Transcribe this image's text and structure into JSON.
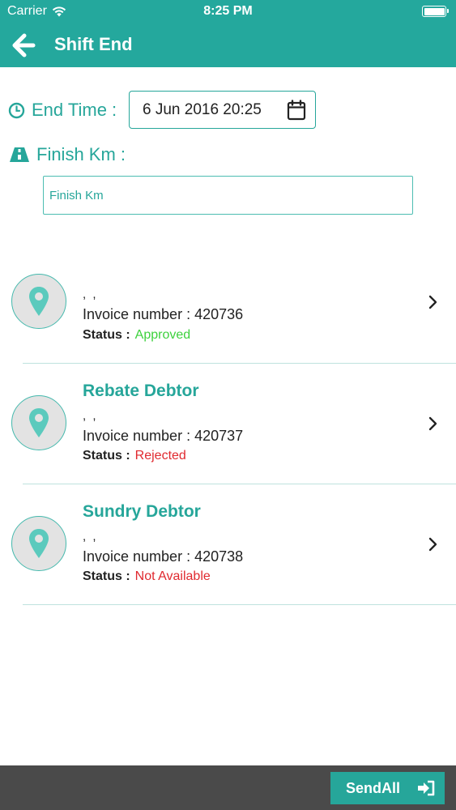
{
  "status_bar": {
    "carrier": "Carrier",
    "time": "8:25 PM"
  },
  "header": {
    "title": "Shift End"
  },
  "form": {
    "end_time_label": "End Time :",
    "end_time_value": "6 Jun 2016 20:25",
    "finish_km_label": "Finish Km :",
    "finish_km_placeholder": "Finish Km",
    "finish_km_value": ""
  },
  "invoices": [
    {
      "title": "",
      "address": ", ,",
      "invoice_label": "Invoice number :",
      "invoice_number": "420736",
      "status_label": "Status :",
      "status": "Approved",
      "status_color": "#3dd13d"
    },
    {
      "title": "Rebate Debtor",
      "address": ", ,",
      "invoice_label": "Invoice number :",
      "invoice_number": "420737",
      "status_label": "Status :",
      "status": "Rejected",
      "status_color": "#e0292f"
    },
    {
      "title": "Sundry Debtor",
      "address": ", ,",
      "invoice_label": "Invoice number :",
      "invoice_number": "420738",
      "status_label": "Status :",
      "status": "Not Available",
      "status_color": "#e0292f"
    }
  ],
  "footer": {
    "send_all_label": "SendAll"
  },
  "icons": {
    "back": "arrow-left-icon",
    "clock": "clock-icon",
    "road": "road-icon",
    "calendar": "calendar-icon",
    "location": "map-pin-icon",
    "chevron": "chevron-right-icon",
    "send": "sign-in-icon",
    "wifi": "wifi-icon",
    "battery": "battery-icon"
  },
  "colors": {
    "primary": "#24a89d",
    "bottom_bar": "#4a4a4a"
  }
}
